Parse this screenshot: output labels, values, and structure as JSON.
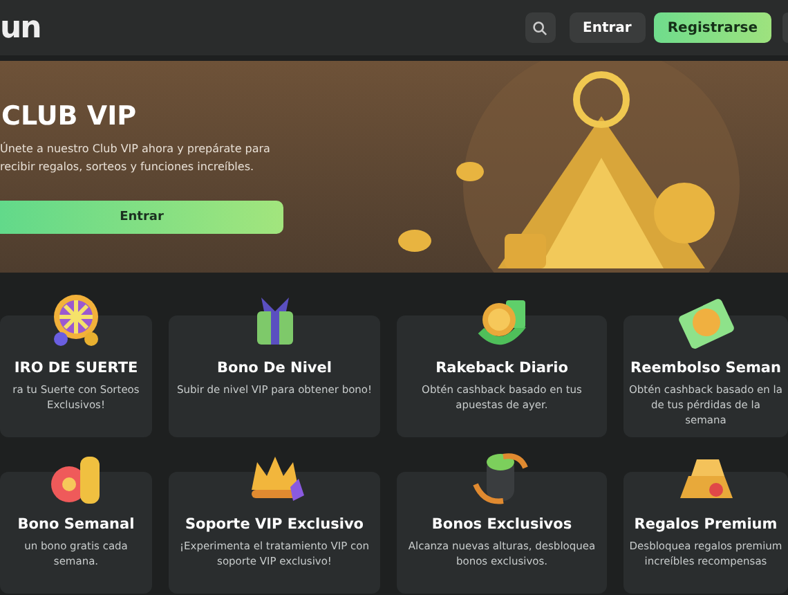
{
  "header": {
    "logo": "un",
    "login": "Entrar",
    "register": "Registrarse"
  },
  "hero": {
    "title": "CLUB VIP",
    "description": "Únete a nuestro Club VIP ahora y prepárate para recibir regalos, sorteos y funciones increíbles.",
    "button": "Entrar"
  },
  "cards": [
    {
      "title": "IRO DE SUERTE",
      "description": "ra tu Suerte con Sorteos Exclusivos!"
    },
    {
      "title": "Bono De Nivel",
      "description": "Subir de nivel VIP para obtener bono!"
    },
    {
      "title": "Rakeback Diario",
      "description": "Obtén cashback basado en tus apuestas de ayer."
    },
    {
      "title": "Reembolso Seman",
      "description": "Obtén cashback basado en la de tus pérdidas de la semana"
    },
    {
      "title": "Bono Semanal",
      "description": "un bono gratis cada semana."
    },
    {
      "title": "Soporte VIP Exclusivo",
      "description": "¡Experimenta el tratamiento VIP con soporte VIP exclusivo!"
    },
    {
      "title": "Bonos Exclusivos",
      "description": "Alcanza nuevas alturas, desbloquea bonos exclusivos."
    },
    {
      "title": "Regalos Premium",
      "description": "Desbloquea regalos premium increíbles recompensas"
    }
  ]
}
